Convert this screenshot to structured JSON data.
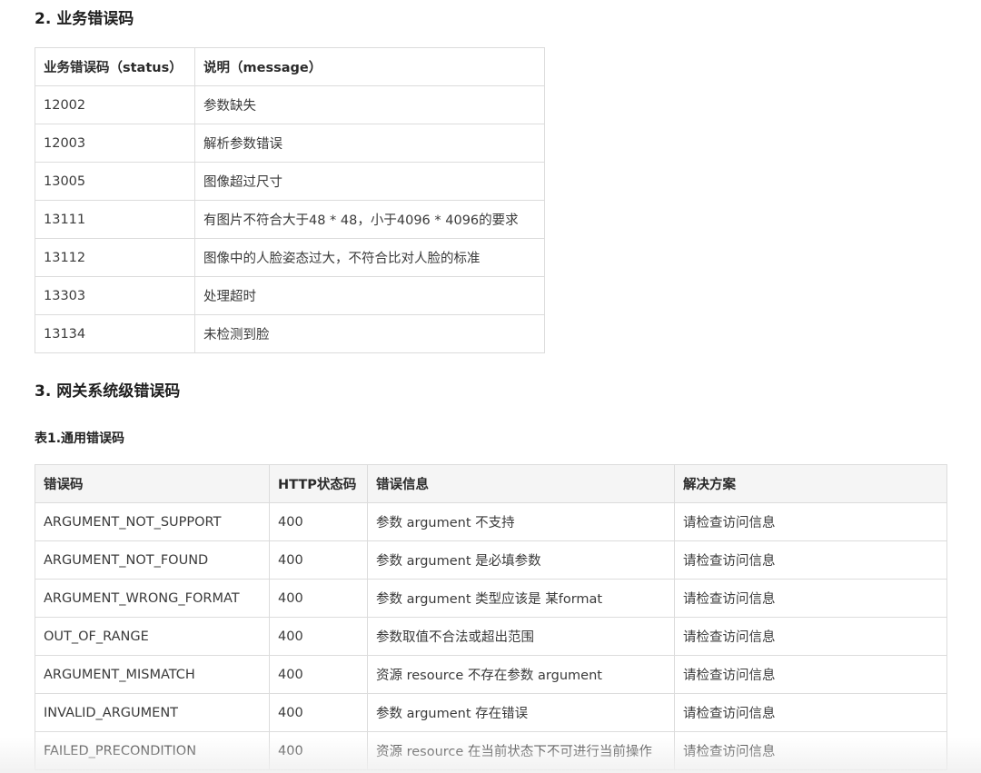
{
  "section2": {
    "heading": "2. 业务错误码",
    "columns": [
      "业务错误码（status）",
      "说明（message）"
    ],
    "rows": [
      [
        "12002",
        "参数缺失"
      ],
      [
        "12003",
        "解析参数错误"
      ],
      [
        "13005",
        "图像超过尺寸"
      ],
      [
        "13111",
        "有图片不符合大于48 * 48，小于4096 * 4096的要求"
      ],
      [
        "13112",
        "图像中的人脸姿态过大，不符合比对人脸的标准"
      ],
      [
        "13303",
        "处理超时"
      ],
      [
        "13134",
        "未检测到脸"
      ]
    ]
  },
  "section3": {
    "heading": "3. 网关系统级错误码",
    "table_caption": "表1.通用错误码",
    "columns": [
      "错误码",
      "HTTP状态码",
      "错误信息",
      "解决方案"
    ],
    "rows": [
      [
        "ARGUMENT_NOT_SUPPORT",
        "400",
        "参数 argument 不支持",
        "请检查访问信息"
      ],
      [
        "ARGUMENT_NOT_FOUND",
        "400",
        "参数 argument 是必填参数",
        "请检查访问信息"
      ],
      [
        "ARGUMENT_WRONG_FORMAT",
        "400",
        "参数 argument 类型应该是 某format",
        "请检查访问信息"
      ],
      [
        "OUT_OF_RANGE",
        "400",
        "参数取值不合法或超出范围",
        "请检查访问信息"
      ],
      [
        "ARGUMENT_MISMATCH",
        "400",
        "资源 resource 不存在参数 argument",
        "请检查访问信息"
      ],
      [
        "INVALID_ARGUMENT",
        "400",
        "参数 argument 存在错误",
        "请检查访问信息"
      ],
      [
        "FAILED_PRECONDITION",
        "400",
        "资源 resource 在当前状态下不可进行当前操作",
        "请检查访问信息"
      ]
    ]
  }
}
